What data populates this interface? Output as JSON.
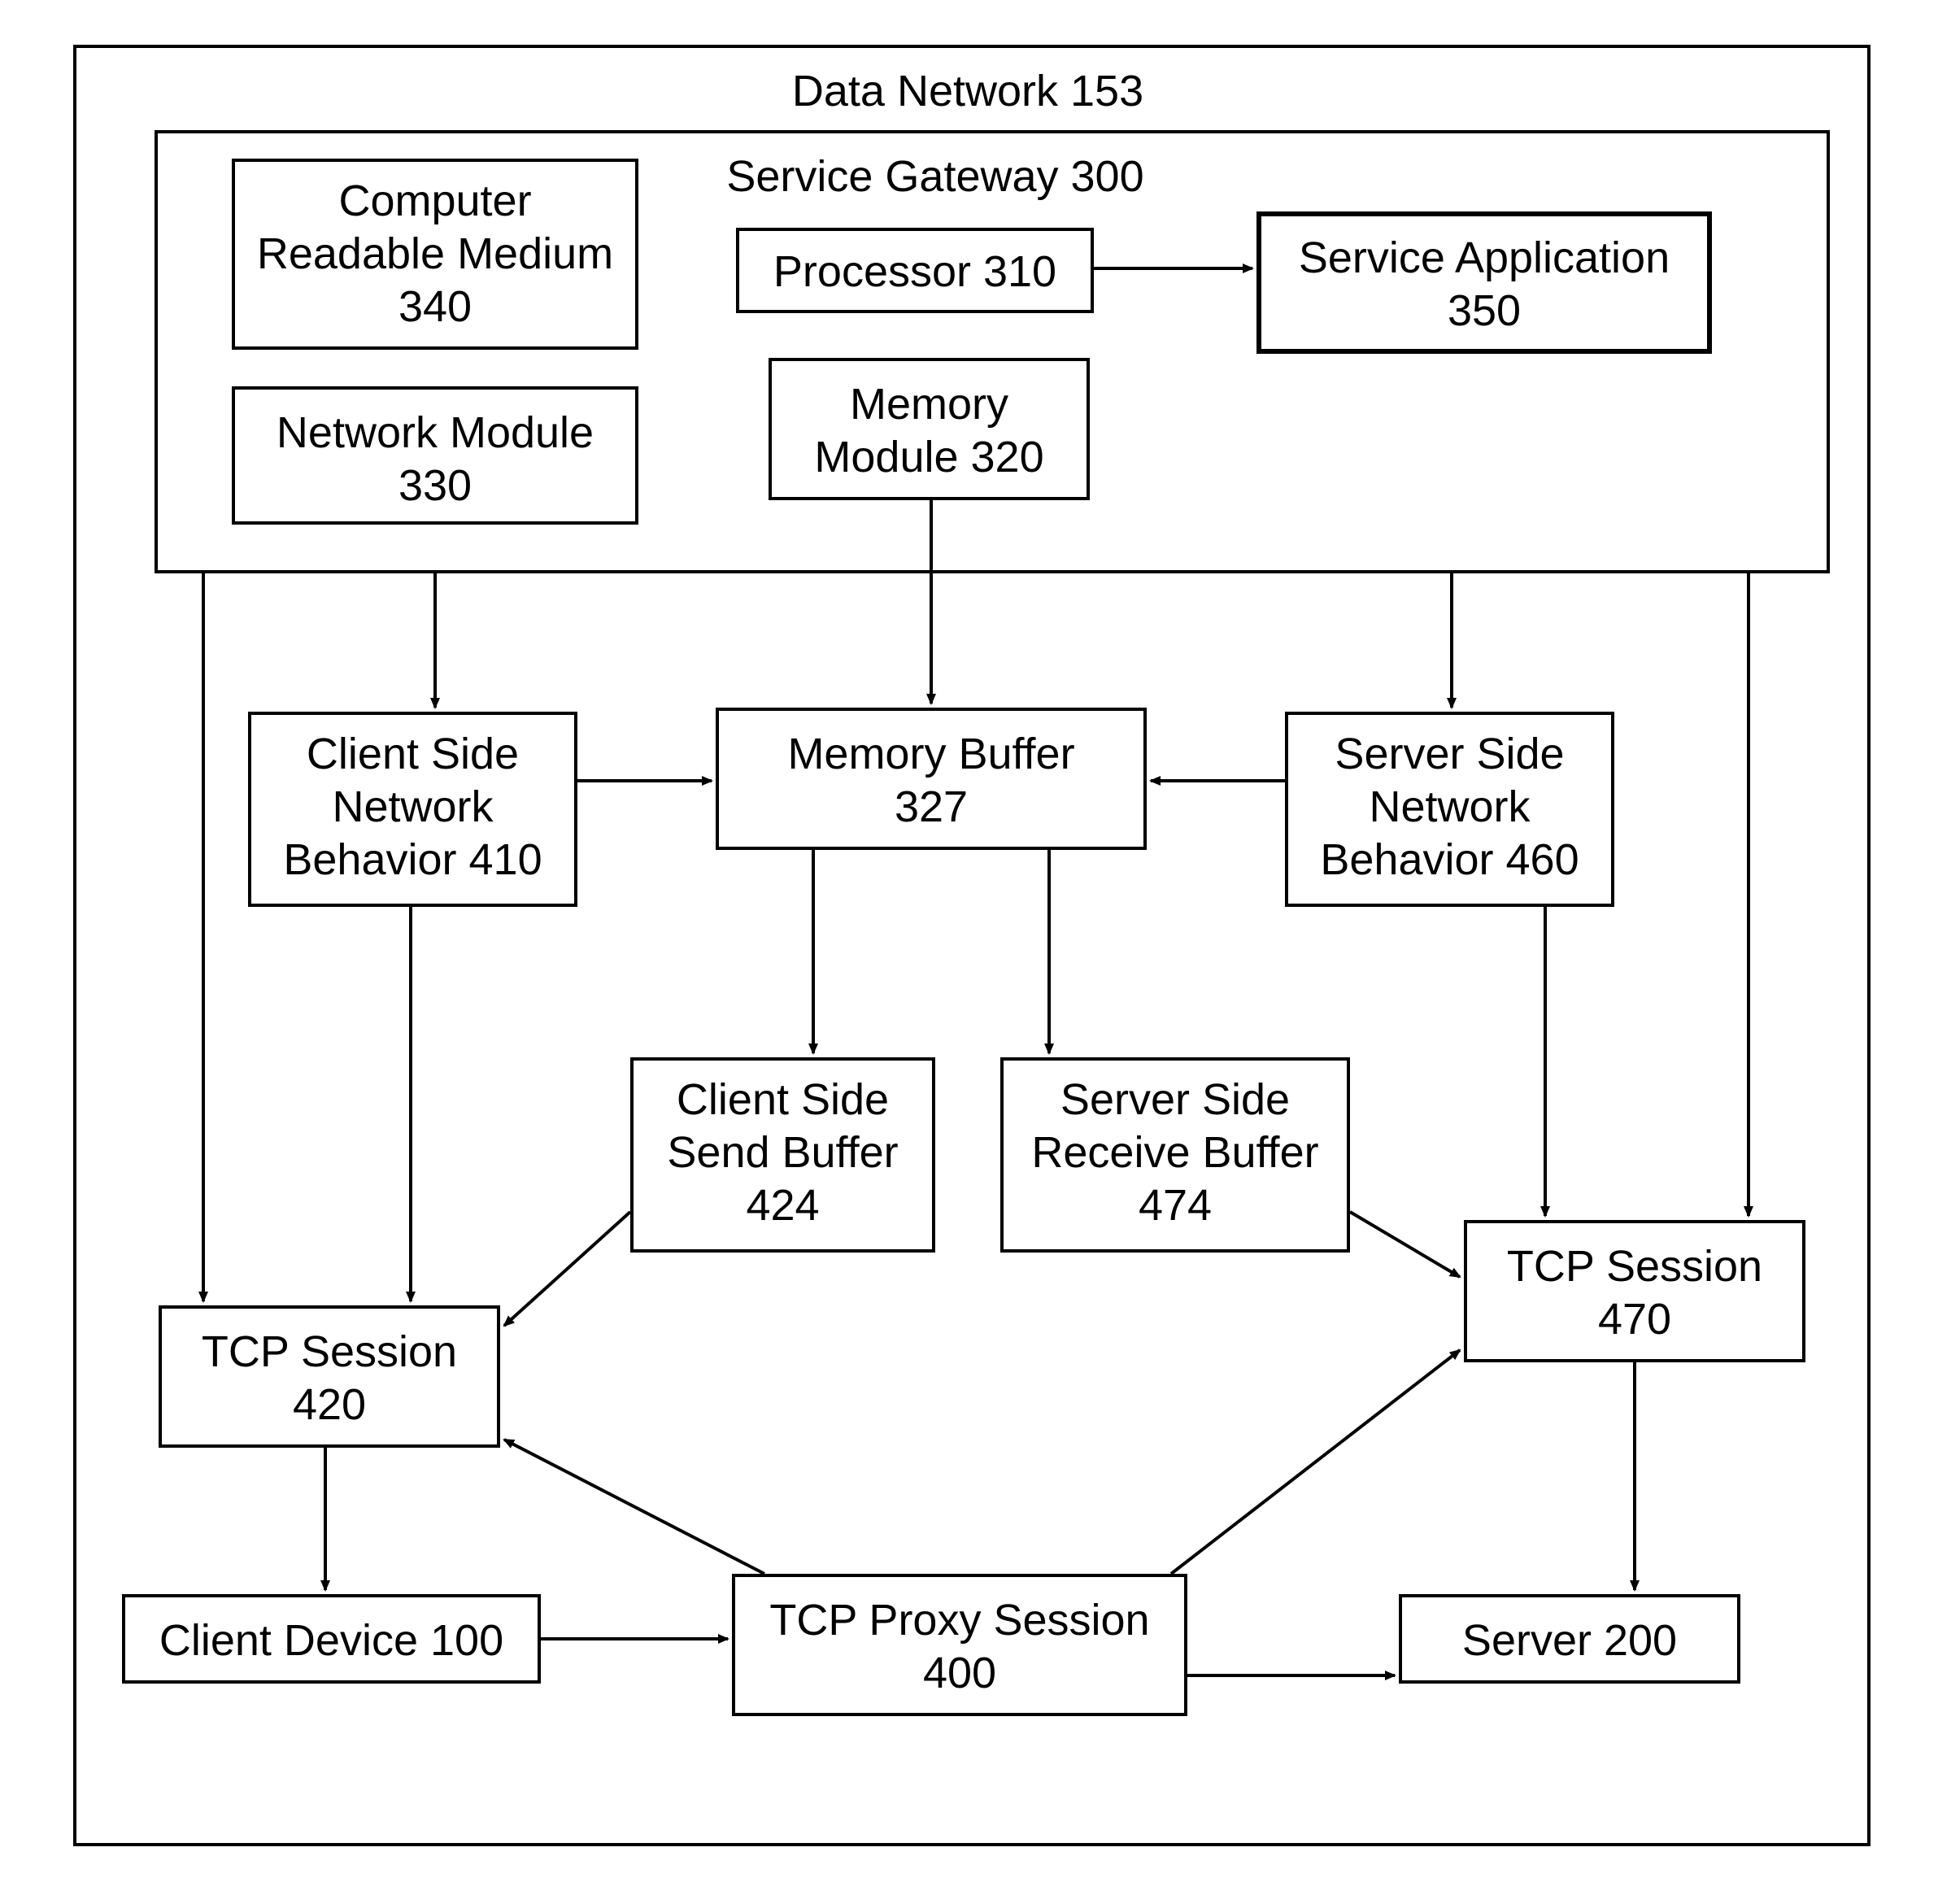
{
  "diagram": {
    "outer_title": "Data Network 153",
    "gateway_title": "Service Gateway 300",
    "boxes": {
      "crm": {
        "line1": "Computer",
        "line2": "Readable Medium",
        "line3": "340"
      },
      "netmod": {
        "line1": "Network Module",
        "line2": "330"
      },
      "processor": {
        "line1": "Processor 310"
      },
      "memmod": {
        "line1": "Memory",
        "line2": "Module 320"
      },
      "svcapp": {
        "line1": "Service Application",
        "line2": "350"
      },
      "membuf": {
        "line1": "Memory Buffer",
        "line2": "327"
      },
      "clientbeh": {
        "line1": "Client Side",
        "line2": "Network",
        "line3": "Behavior 410"
      },
      "serverbeh": {
        "line1": "Server Side",
        "line2": "Network",
        "line3": "Behavior 460"
      },
      "csendbuf": {
        "line1": "Client Side",
        "line2": "Send Buffer",
        "line3": "424"
      },
      "srecvbuf": {
        "line1": "Server Side",
        "line2": "Receive Buffer",
        "line3": "474"
      },
      "tcp420": {
        "line1": "TCP Session",
        "line2": "420"
      },
      "tcp470": {
        "line1": "TCP Session",
        "line2": "470"
      },
      "client": {
        "line1": "Client Device 100"
      },
      "proxy": {
        "line1": "TCP Proxy Session",
        "line2": "400"
      },
      "server": {
        "line1": "Server 200"
      }
    }
  }
}
